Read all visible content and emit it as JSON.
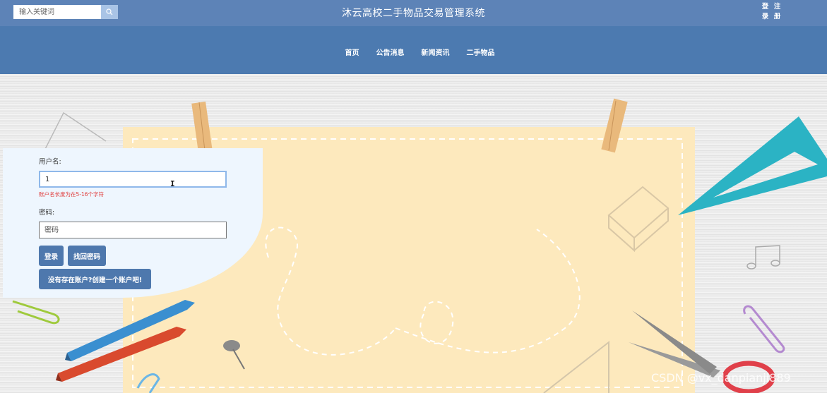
{
  "header": {
    "search_placeholder": "输入关键词",
    "title": "沐云高校二手物品交易管理系统",
    "login_label": "登录",
    "register_label": "注册"
  },
  "nav": {
    "items": [
      "首页",
      "公告消息",
      "新闻资讯",
      "二手物品"
    ]
  },
  "login_form": {
    "username_label": "用户名:",
    "username_value": "1",
    "username_error": "账户名长度为在5-16个字符",
    "password_label": "密码:",
    "password_placeholder": "密码",
    "login_button": "登录",
    "forgot_button": "找回密码",
    "register_button": "没有存在账户?创建一个账户吧!"
  },
  "watermark": "CSDN @vx_danpianji889",
  "colors": {
    "topbar": "#5d83b7",
    "navbar": "#4c7ab0",
    "button": "#4e78ad",
    "panel": "#eef6fe",
    "error": "#e03a3a"
  }
}
